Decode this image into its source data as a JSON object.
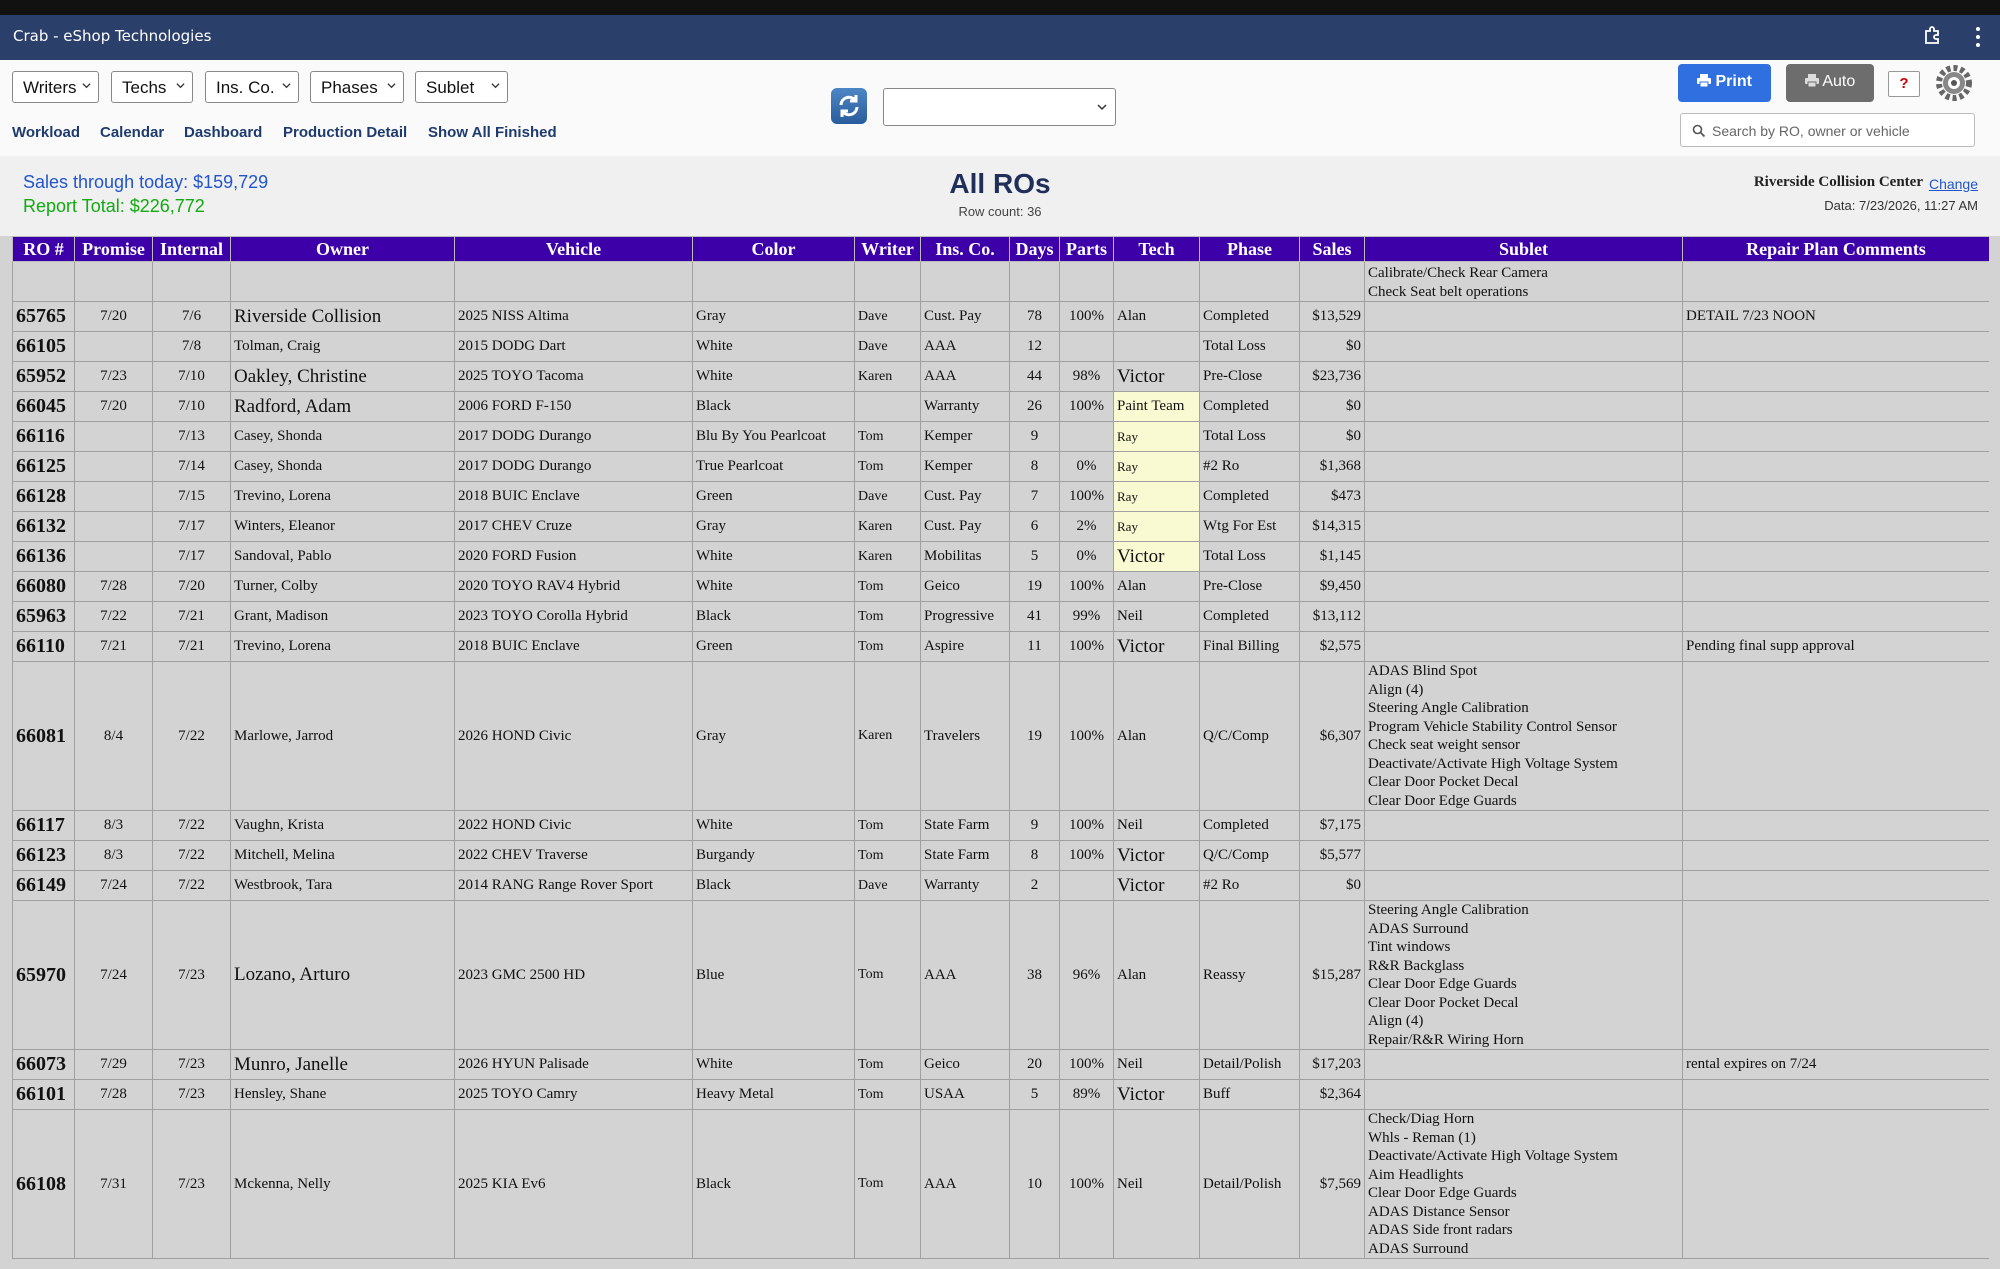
{
  "window": {
    "title": "Crab - eShop Technologies"
  },
  "filters": [
    {
      "label": "Writers"
    },
    {
      "label": "Techs"
    },
    {
      "label": "Ins. Co."
    },
    {
      "label": "Phases"
    },
    {
      "label": "Sublet"
    }
  ],
  "nav": {
    "workload": "Workload",
    "calendar": "Calendar",
    "dashboard": "Dashboard",
    "production_detail": "Production Detail",
    "show_all_finished": "Show All Finished"
  },
  "view_select": {
    "value": ""
  },
  "actions": {
    "print": "Print",
    "auto": "Auto",
    "help": "?"
  },
  "search": {
    "placeholder": "Search by RO, owner or vehicle"
  },
  "summary": {
    "sales_today": "Sales through today: $159,729",
    "report_total": "Report Total: $226,772",
    "title": "All ROs",
    "row_count": "Row count: 36",
    "shop": "Riverside Collision Center",
    "change": "Change",
    "data_ts": "Data: 7/23/2026, 11:27 AM"
  },
  "table": {
    "headers": [
      "RO #",
      "Promise",
      "Internal",
      "Owner",
      "Vehicle",
      "Color",
      "Writer",
      "Ins. Co.",
      "Days",
      "Parts",
      "Tech",
      "Phase",
      "Sales",
      "Sublet",
      "Repair Plan Comments"
    ],
    "partial_sublet": "Calibrate/Check Rear Camera\nCheck Seat belt operations",
    "rows": [
      {
        "ro": "65765",
        "promise": "7/20",
        "internal": "7/6",
        "owner": "Riverside Collision",
        "vehicle": "2025 NISS Altima",
        "color": "Gray",
        "writer": "Dave",
        "ins": "Cust. Pay",
        "days": "78",
        "parts": "100%",
        "tech": "Alan",
        "phase": "Completed",
        "sales": "$13,529",
        "sublet": "",
        "comments": "DETAIL 7/23 NOON"
      },
      {
        "ro": "66105",
        "promise": "",
        "internal": "7/8",
        "owner": "Tolman, Craig",
        "vehicle": "2015 DODG Dart",
        "color": "White",
        "writer": "Dave",
        "ins": "AAA",
        "days": "12",
        "parts": "",
        "tech": "",
        "phase": "Total Loss",
        "sales": "$0",
        "sublet": "",
        "comments": ""
      },
      {
        "ro": "65952",
        "promise": "7/23",
        "internal": "7/10",
        "owner": "Oakley, Christine",
        "vehicle": "2025 TOYO Tacoma",
        "color": "White",
        "writer": "Karen",
        "ins": "AAA",
        "days": "44",
        "parts": "98%",
        "tech": "Victor",
        "phase": "Pre-Close",
        "sales": "$23,736",
        "sublet": "",
        "comments": ""
      },
      {
        "ro": "66045",
        "promise": "7/20",
        "internal": "7/10",
        "owner": "Radford, Adam",
        "vehicle": "2006 FORD F-150",
        "color": "Black",
        "writer": "",
        "ins": "Warranty",
        "days": "26",
        "parts": "100%",
        "tech": "Paint Team",
        "phase": "Completed",
        "sales": "$0",
        "sublet": "",
        "comments": ""
      },
      {
        "ro": "66116",
        "promise": "",
        "internal": "7/13",
        "owner": "Casey, Shonda",
        "vehicle": "2017 DODG Durango",
        "color": "Blu By You Pearlcoat",
        "writer": "Tom",
        "ins": "Kemper",
        "days": "9",
        "parts": "",
        "tech": "Ray",
        "phase": "Total Loss",
        "sales": "$0",
        "sublet": "",
        "comments": ""
      },
      {
        "ro": "66125",
        "promise": "",
        "internal": "7/14",
        "owner": "Casey, Shonda",
        "vehicle": "2017 DODG Durango",
        "color": "True Pearlcoat",
        "writer": "Tom",
        "ins": "Kemper",
        "days": "8",
        "parts": "0%",
        "tech": "Ray",
        "phase": "#2 Ro",
        "sales": "$1,368",
        "sublet": "",
        "comments": ""
      },
      {
        "ro": "66128",
        "promise": "",
        "internal": "7/15",
        "owner": "Trevino, Lorena",
        "vehicle": "2018 BUIC Enclave",
        "color": "Green",
        "writer": "Dave",
        "ins": "Cust. Pay",
        "days": "7",
        "parts": "100%",
        "tech": "Ray",
        "phase": "Completed",
        "sales": "$473",
        "sublet": "",
        "comments": ""
      },
      {
        "ro": "66132",
        "promise": "",
        "internal": "7/17",
        "owner": "Winters, Eleanor",
        "vehicle": "2017 CHEV Cruze",
        "color": "Gray",
        "writer": "Karen",
        "ins": "Cust. Pay",
        "days": "6",
        "parts": "2%",
        "tech": "Ray",
        "phase": "Wtg For Est",
        "sales": "$14,315",
        "sublet": "",
        "comments": ""
      },
      {
        "ro": "66136",
        "promise": "",
        "internal": "7/17",
        "owner": "Sandoval, Pablo",
        "vehicle": "2020 FORD Fusion",
        "color": "White",
        "writer": "Karen",
        "ins": "Mobilitas",
        "days": "5",
        "parts": "0%",
        "tech": "Victor",
        "phase": "Total Loss",
        "sales": "$1,145",
        "sublet": "",
        "comments": ""
      },
      {
        "ro": "66080",
        "promise": "7/28",
        "internal": "7/20",
        "owner": "Turner, Colby",
        "vehicle": "2020 TOYO RAV4 Hybrid",
        "color": "White",
        "writer": "Tom",
        "ins": "Geico",
        "days": "19",
        "parts": "100%",
        "tech": "Alan",
        "phase": "Pre-Close",
        "sales": "$9,450",
        "sublet": "",
        "comments": ""
      },
      {
        "ro": "65963",
        "promise": "7/22",
        "internal": "7/21",
        "owner": "Grant, Madison",
        "vehicle": "2023 TOYO Corolla Hybrid",
        "color": "Black",
        "writer": "Tom",
        "ins": "Progressive",
        "days": "41",
        "parts": "99%",
        "tech": "Neil",
        "phase": "Completed",
        "sales": "$13,112",
        "sublet": "",
        "comments": ""
      },
      {
        "ro": "66110",
        "promise": "7/21",
        "internal": "7/21",
        "owner": "Trevino, Lorena",
        "vehicle": "2018 BUIC Enclave",
        "color": "Green",
        "writer": "Tom",
        "ins": "Aspire",
        "days": "11",
        "parts": "100%",
        "tech": "Victor",
        "phase": "Final Billing",
        "sales": "$2,575",
        "sublet": "",
        "comments": "Pending final supp approval"
      },
      {
        "ro": "66081",
        "promise": "8/4",
        "internal": "7/22",
        "owner": "Marlowe, Jarrod",
        "vehicle": "2026 HOND Civic",
        "color": "Gray",
        "writer": "Karen",
        "ins": "Travelers",
        "days": "19",
        "parts": "100%",
        "tech": "Alan",
        "phase": "Q/C/Comp",
        "sales": "$6,307",
        "sublet": "ADAS Blind Spot\nAlign (4)\nSteering Angle Calibration\nProgram Vehicle Stability Control Sensor\nCheck seat weight sensor\nDeactivate/Activate High Voltage System\nClear Door Pocket Decal\nClear Door Edge Guards",
        "comments": ""
      },
      {
        "ro": "66117",
        "promise": "8/3",
        "internal": "7/22",
        "owner": "Vaughn, Krista",
        "vehicle": "2022 HOND Civic",
        "color": "White",
        "writer": "Tom",
        "ins": "State Farm",
        "days": "9",
        "parts": "100%",
        "tech": "Neil",
        "phase": "Completed",
        "sales": "$7,175",
        "sublet": "",
        "comments": ""
      },
      {
        "ro": "66123",
        "promise": "8/3",
        "internal": "7/22",
        "owner": "Mitchell, Melina",
        "vehicle": "2022 CHEV Traverse",
        "color": "Burgandy",
        "writer": "Tom",
        "ins": "State Farm",
        "days": "8",
        "parts": "100%",
        "tech": "Victor",
        "phase": "Q/C/Comp",
        "sales": "$5,577",
        "sublet": "",
        "comments": ""
      },
      {
        "ro": "66149",
        "promise": "7/24",
        "internal": "7/22",
        "owner": "Westbrook, Tara",
        "vehicle": "2014 RANG Range Rover Sport",
        "color": "Black",
        "writer": "Dave",
        "ins": "Warranty",
        "days": "2",
        "parts": "",
        "tech": "Victor",
        "phase": "#2 Ro",
        "sales": "$0",
        "sublet": "",
        "comments": ""
      },
      {
        "ro": "65970",
        "promise": "7/24",
        "internal": "7/23",
        "owner": "Lozano, Arturo",
        "vehicle": "2023 GMC 2500 HD",
        "color": "Blue",
        "writer": "Tom",
        "ins": "AAA",
        "days": "38",
        "parts": "96%",
        "tech": "Alan",
        "phase": "Reassy",
        "sales": "$15,287",
        "sublet": "Steering Angle Calibration\nADAS Surround\nTint windows\nR&R Backglass\nClear Door Edge Guards\nClear Door Pocket Decal\nAlign (4)\nRepair/R&R Wiring Horn",
        "comments": ""
      },
      {
        "ro": "66073",
        "promise": "7/29",
        "internal": "7/23",
        "owner": "Munro, Janelle",
        "vehicle": "2026 HYUN Palisade",
        "color": "White",
        "writer": "Tom",
        "ins": "Geico",
        "days": "20",
        "parts": "100%",
        "tech": "Neil",
        "phase": "Detail/Polish",
        "sales": "$17,203",
        "sublet": "",
        "comments": "rental expires on 7/24"
      },
      {
        "ro": "66101",
        "promise": "7/28",
        "internal": "7/23",
        "owner": "Hensley, Shane",
        "vehicle": "2025 TOYO Camry",
        "color": "Heavy Metal",
        "writer": "Tom",
        "ins": "USAA",
        "days": "5",
        "parts": "89%",
        "tech": "Victor",
        "phase": "Buff",
        "sales": "$2,364",
        "sublet": "",
        "comments": ""
      },
      {
        "ro": "66108",
        "promise": "7/31",
        "internal": "7/23",
        "owner": "Mckenna, Nelly",
        "vehicle": "2025 KIA Ev6",
        "color": "Black",
        "writer": "Tom",
        "ins": "AAA",
        "days": "10",
        "parts": "100%",
        "tech": "Neil",
        "phase": "Detail/Polish",
        "sales": "$7,569",
        "sublet": "Check/Diag Horn\nWhls - Reman (1)\nDeactivate/Activate High Voltage System\nAim Headlights\nClear Door Edge Guards\nADAS Distance Sensor\nADAS Side front radars\nADAS Surround",
        "comments": ""
      }
    ]
  },
  "colors": {
    "header_bg": "#3d00a8",
    "titlebar": "#2b3f6b",
    "print_btn": "#2f6fe0",
    "tech_highlight": "#fafad2"
  }
}
